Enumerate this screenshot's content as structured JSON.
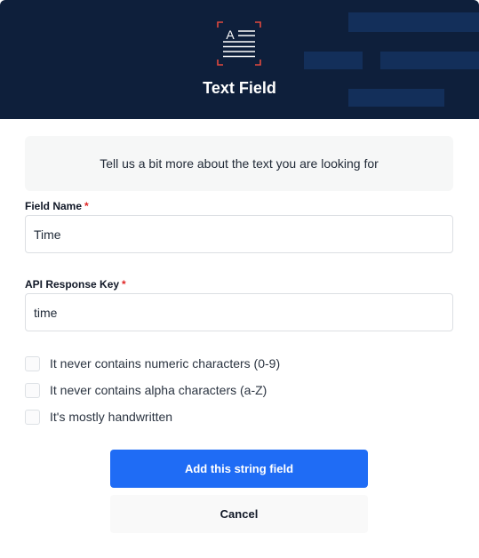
{
  "header": {
    "title": "Text Field",
    "icon": "text-field-icon",
    "icon_letter": "A",
    "background_color": "#0e1f3b",
    "accent_color": "#e0483e"
  },
  "info": {
    "text": "Tell us a bit more about the text you are looking for"
  },
  "fields": {
    "field_name": {
      "label": "Field Name",
      "required_mark": "*",
      "value": "Time"
    },
    "api_key": {
      "label": "API Response Key",
      "required_mark": "*",
      "value": "time"
    }
  },
  "options": [
    {
      "label": "It never contains numeric characters (0-9)",
      "checked": false
    },
    {
      "label": "It never contains alpha characters (a-Z)",
      "checked": false
    },
    {
      "label": "It's mostly handwritten",
      "checked": false
    }
  ],
  "actions": {
    "primary_label": "Add this string field",
    "primary_color": "#1f6cf5",
    "cancel_label": "Cancel"
  }
}
